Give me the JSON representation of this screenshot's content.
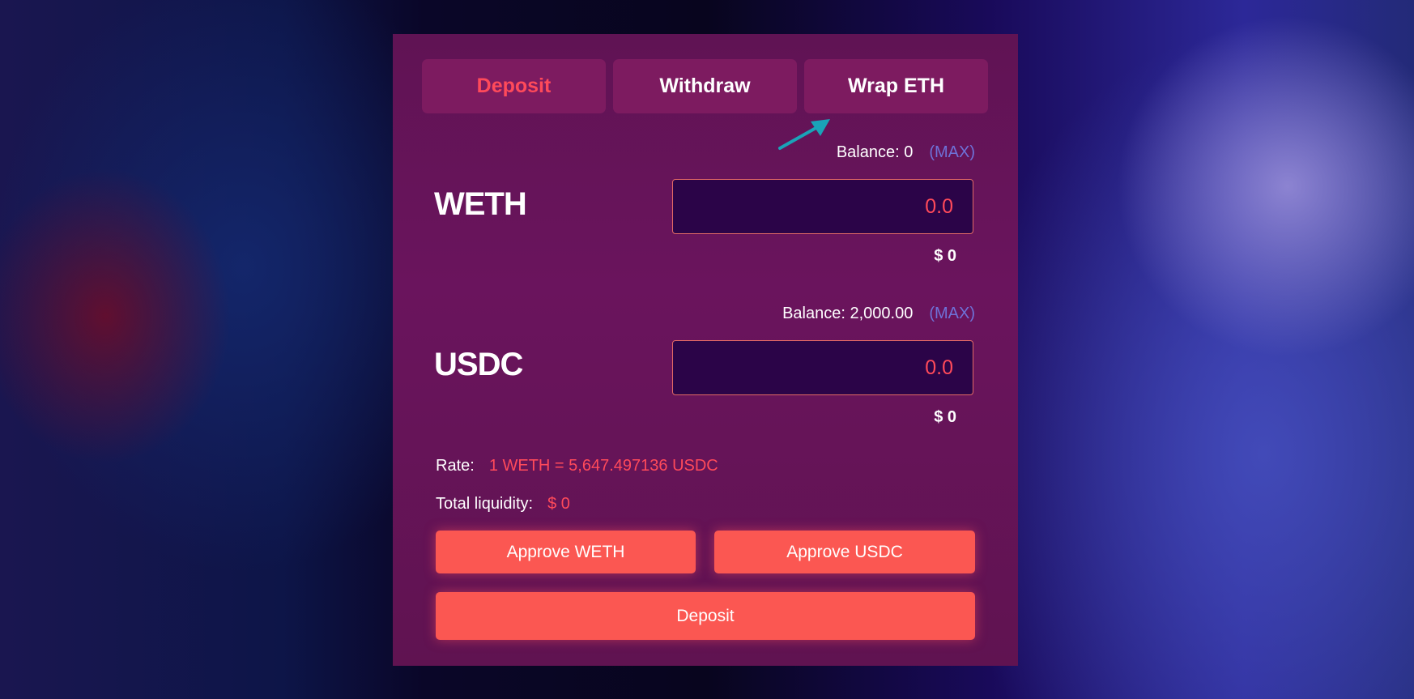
{
  "tabs": [
    "Deposit",
    "Withdraw",
    "Wrap ETH"
  ],
  "active_tab": "Deposit",
  "colors": {
    "accent": "#ff4a5a",
    "button": "#fb5752",
    "max_link": "#6e72d8",
    "card": "#6a145d",
    "arrow": "#1aa3b8"
  },
  "weth": {
    "balance_label": "Balance: 0",
    "max_label": "(MAX)",
    "token": "WETH",
    "amount": "0.0",
    "usd_value": "$ 0"
  },
  "usdc": {
    "balance_label": "Balance: 2,000.00",
    "max_label": "(MAX)",
    "token": "USDC",
    "amount": "0.0",
    "usd_value": "$ 0"
  },
  "rate": {
    "label": "Rate:",
    "value": "1 WETH = 5,647.497136 USDC"
  },
  "liquidity": {
    "label": "Total liquidity:",
    "value": "$ 0"
  },
  "buttons": {
    "approve_weth": "Approve WETH",
    "approve_usdc": "Approve USDC",
    "deposit": "Deposit"
  }
}
